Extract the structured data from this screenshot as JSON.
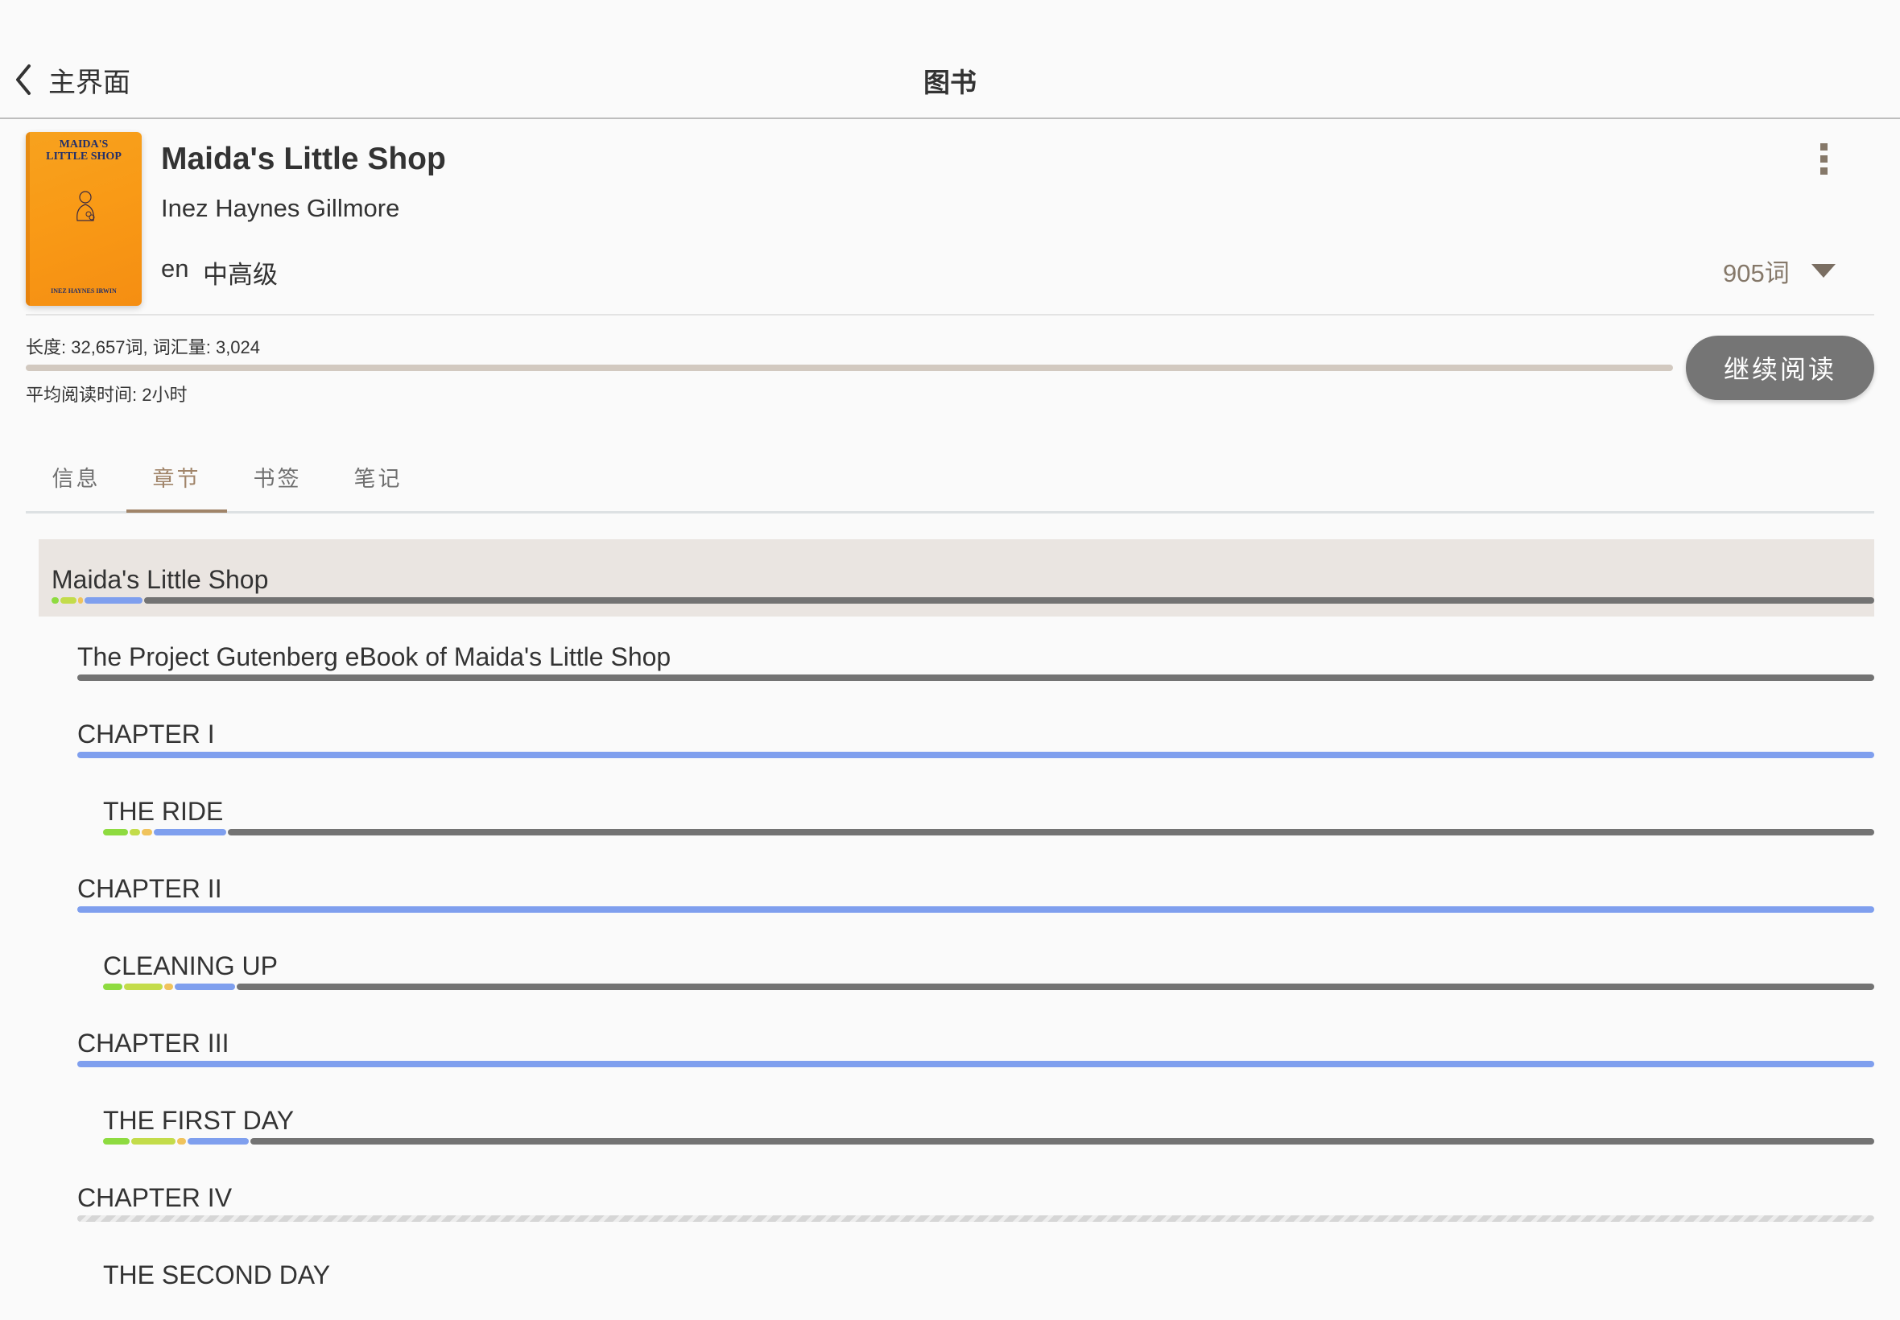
{
  "header": {
    "back_label": "主界面",
    "title": "图书"
  },
  "book": {
    "cover": {
      "title_line1": "MAIDA'S",
      "title_line2": "LITTLE SHOP",
      "author": "INEZ HAYNES IRWIN",
      "color": "#F99A16"
    },
    "title": "Maida's Little Shop",
    "author": "Inez Haynes Gillmore",
    "language": "en",
    "level": "中高级",
    "word_count_selector": "905词",
    "stats": "长度: 32,657词, 词汇量: 3,024",
    "reading_progress_percent": 0,
    "avg_reading_time": "平均阅读时间: 2小时",
    "continue_label": "继续阅读"
  },
  "tabs": [
    {
      "label": "信息",
      "active": false
    },
    {
      "label": "章节",
      "active": true
    },
    {
      "label": "书签",
      "active": false
    },
    {
      "label": "笔记",
      "active": false
    }
  ],
  "colors": {
    "accent": "#A08469",
    "known": "#8EDB40",
    "familiar": "#C3DC4A",
    "learning": "#F0C35C",
    "new": "#7F9FEE",
    "unread": "#737373",
    "highlight_bg": "#EAE5E1"
  },
  "chapters": [
    {
      "label": "Maida's Little Shop",
      "level": 0,
      "selected": true,
      "segments": [
        {
          "type": "known",
          "pct": 0.4
        },
        {
          "type": "familiar",
          "pct": 0.9
        },
        {
          "type": "learning",
          "pct": 0.2
        },
        {
          "type": "new",
          "pct": 3.2
        },
        {
          "type": "unread",
          "pct": 95.3
        }
      ]
    },
    {
      "label": "The Project Gutenberg eBook of Maida's Little Shop",
      "level": 1,
      "selected": false,
      "segments": [
        {
          "type": "unread",
          "pct": 100
        }
      ]
    },
    {
      "label": "CHAPTER I",
      "level": 1,
      "selected": false,
      "segments": [
        {
          "type": "new",
          "pct": 100
        }
      ]
    },
    {
      "label": "THE RIDE",
      "level": 2,
      "selected": false,
      "segments": [
        {
          "type": "known",
          "pct": 1.4
        },
        {
          "type": "familiar",
          "pct": 0.6
        },
        {
          "type": "learning",
          "pct": 0.6
        },
        {
          "type": "new",
          "pct": 4.1
        },
        {
          "type": "unread",
          "pct": 93.3
        }
      ]
    },
    {
      "label": "CHAPTER II",
      "level": 1,
      "selected": false,
      "segments": [
        {
          "type": "new",
          "pct": 100
        }
      ]
    },
    {
      "label": "CLEANING UP",
      "level": 2,
      "selected": false,
      "segments": [
        {
          "type": "known",
          "pct": 1.1
        },
        {
          "type": "familiar",
          "pct": 2.2
        },
        {
          "type": "learning",
          "pct": 0.5
        },
        {
          "type": "new",
          "pct": 3.4
        },
        {
          "type": "unread",
          "pct": 92.8
        }
      ]
    },
    {
      "label": "CHAPTER III",
      "level": 1,
      "selected": false,
      "segments": [
        {
          "type": "new",
          "pct": 100
        }
      ]
    },
    {
      "label": "THE FIRST DAY",
      "level": 2,
      "selected": false,
      "segments": [
        {
          "type": "known",
          "pct": 1.5
        },
        {
          "type": "familiar",
          "pct": 2.5
        },
        {
          "type": "learning",
          "pct": 0.5
        },
        {
          "type": "new",
          "pct": 3.5
        },
        {
          "type": "unread",
          "pct": 92.0
        }
      ]
    },
    {
      "label": "CHAPTER IV",
      "level": 1,
      "selected": false,
      "status": "loading",
      "segments": []
    },
    {
      "label": "THE SECOND DAY",
      "level": 2,
      "selected": false,
      "segments": []
    }
  ]
}
